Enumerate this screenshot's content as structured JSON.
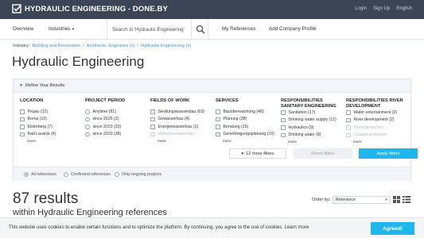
{
  "header": {
    "brand": "HYDRAULIC ENGINEERING - DONE.BY",
    "links": [
      "Login",
      "Sign Up",
      "English"
    ]
  },
  "nav": {
    "overview": "Overview",
    "industries": "Industries",
    "search_value": "Search in 'Hydraulic Engineering'",
    "my_references": "My References",
    "add_company_profile": "Add Company Profile"
  },
  "breadcrumb": {
    "prefix": "Industry:",
    "items": [
      "Building and Renovation",
      "Architects, Engineers (s)",
      "Hydraulic Engineering (s)"
    ]
  },
  "page_title": "Hydraulic Engineering",
  "filters": {
    "refine_label": "Refine Your Results",
    "columns": [
      {
        "title": "LOCATION",
        "options": [
          "Pegau (12)",
          "Borna (10)",
          "Elsterberg (7)",
          "Bad Lausick (4)"
        ],
        "more": "more"
      },
      {
        "title": "PROJECT PERIOD",
        "options": [
          "Anytime (81)",
          "since 2025 (2)",
          "since 2023 (20)",
          "since 2020 (38)"
        ],
        "more": ""
      },
      {
        "title": "FIELDS OF WORK",
        "options": [
          "Siedlungswasserbau (63)",
          "Gewässerbau (4)",
          "Energiewasserbau (1)",
          "Verkehrswasserbau"
        ],
        "more": "more"
      },
      {
        "title": "SERVICES",
        "options": [
          "Bauüberwachung (48)",
          "Planung (38)",
          "Beratung (15)",
          "Genehmigungsplanung (10)"
        ],
        "more": "more"
      },
      {
        "title": "RESPONSIBILITIES SANITARY ENGINEERING",
        "options": [
          "Sanitation (17)",
          "Drinking water supply (12)",
          "Hydraulics (9)",
          "Drinking water (8)"
        ],
        "more": "more"
      },
      {
        "title": "RESPONSIBILITIES RIVER DEVELOPMENT",
        "options": [
          "Water entertainment (2)",
          "River development (2)",
          "Flood protection",
          "Coastal protection"
        ],
        "more": "more"
      }
    ],
    "more_filters": "12 more filters",
    "reset": "Reset filters",
    "apply": "Apply filters",
    "reference_scope": [
      "All references",
      "Confirmed references",
      "Only ongoing projects"
    ]
  },
  "results": {
    "count": "87 results",
    "subtitle": "within Hydraulic Engineering references",
    "order_label": "Order by:",
    "order_value": "Relevance"
  },
  "cookie": {
    "text": "This website uses cookies to enable certain functions and to optimize the platform. By continuing, you agree to the use of cookies.",
    "link": "Learn more",
    "accept": "Agreed!"
  },
  "colors": {
    "topbar": "#3b4556",
    "accent": "#1fb6ee",
    "link": "#4a8fcf"
  }
}
